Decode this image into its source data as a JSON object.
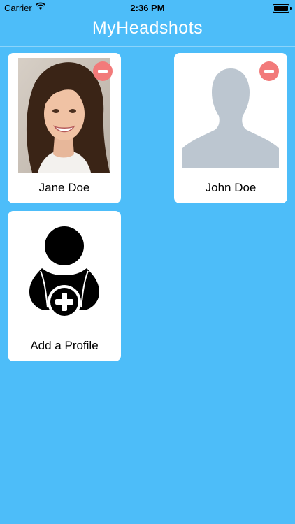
{
  "status_bar": {
    "carrier": "Carrier",
    "time": "2:36 PM"
  },
  "nav": {
    "title": "MyHeadshots"
  },
  "profiles": [
    {
      "name": "Jane Doe",
      "photo": "headshot-photo"
    },
    {
      "name": "John Doe",
      "photo": "person-silhouette-icon"
    }
  ],
  "add_profile": {
    "label": "Add a Profile",
    "icon": "add-user-icon"
  },
  "colors": {
    "background": "#4dbdf9",
    "card": "#ffffff",
    "remove": "#f27a7a",
    "silhouette": "#bcc6d0"
  }
}
